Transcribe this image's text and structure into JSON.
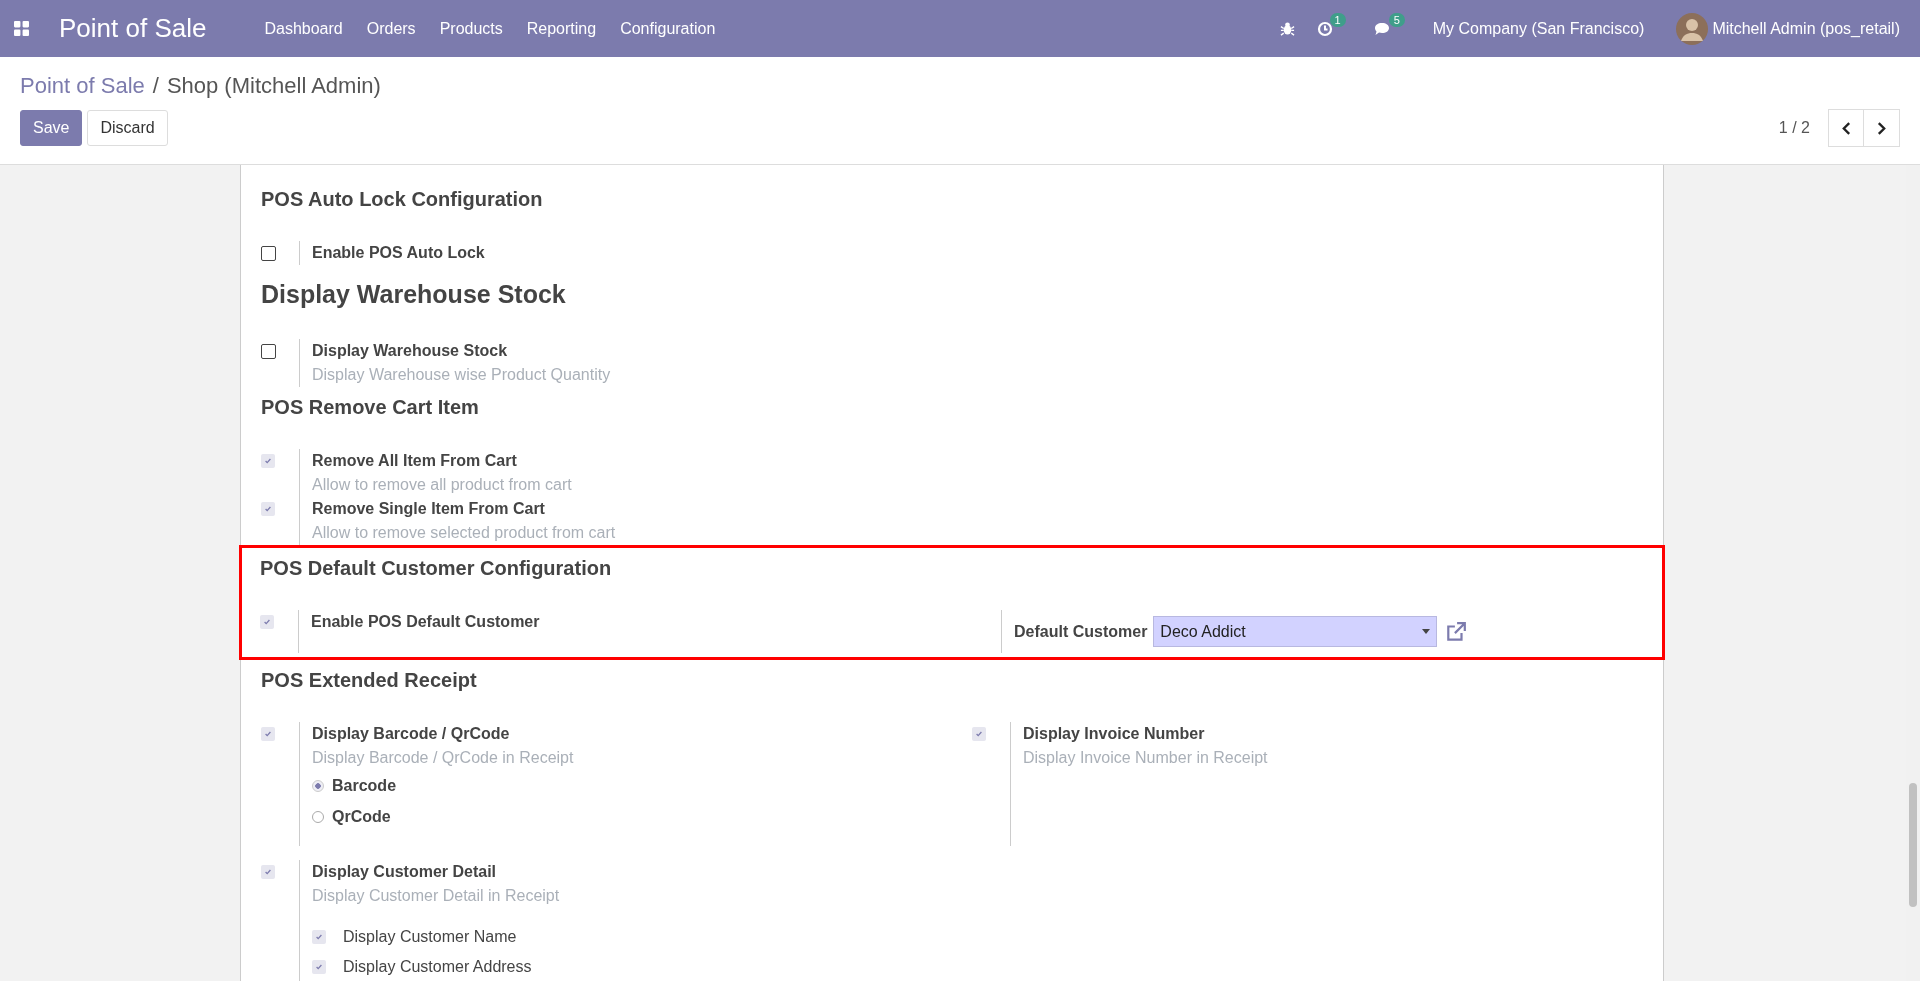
{
  "navbar": {
    "app_name": "Point of Sale",
    "menu": [
      "Dashboard",
      "Orders",
      "Products",
      "Reporting",
      "Configuration"
    ],
    "activity_badge": "1",
    "message_badge": "5",
    "company": "My Company (San Francisco)",
    "user": "Mitchell Admin (pos_retail)"
  },
  "breadcrumb": {
    "items": [
      {
        "label": "Point of Sale",
        "kind": "link"
      },
      {
        "label": "Shop (Mitchell Admin)",
        "kind": "current"
      }
    ],
    "separator": "/"
  },
  "buttons": [
    {
      "label": "Save",
      "kind": "primary"
    },
    {
      "label": "Discard",
      "kind": "secondary"
    }
  ],
  "pager": "1 / 2",
  "sections": [
    {
      "title": "POS Auto Lock Configuration",
      "large": false,
      "highlighted": false,
      "rows": [
        {
          "cells": [
            {
              "kind": "checkbox",
              "label": "Enable POS Auto Lock",
              "checked": false
            }
          ]
        }
      ]
    },
    {
      "title": "Display Warehouse Stock",
      "large": true,
      "highlighted": false,
      "rows": [
        {
          "cells": [
            {
              "kind": "checkbox",
              "label": "Display Warehouse Stock",
              "description": "Display Warehouse wise Product Quantity",
              "checked": false
            }
          ]
        }
      ]
    },
    {
      "title": "POS Remove Cart Item",
      "large": false,
      "highlighted": false,
      "rows": [
        {
          "cells": [
            {
              "kind": "checkbox",
              "label": "Remove All Item From Cart",
              "description": "Allow to remove all product from cart",
              "checked": true
            }
          ]
        },
        {
          "cells": [
            {
              "kind": "checkbox",
              "label": "Remove Single Item From Cart",
              "description": "Allow to remove selected product from cart",
              "checked": true
            }
          ]
        }
      ]
    },
    {
      "title": "POS Default Customer Configuration",
      "large": false,
      "highlighted": true,
      "rows": [
        {
          "cells": [
            {
              "kind": "checkbox",
              "label": "Enable POS Default Customer",
              "checked": true
            },
            {
              "kind": "field",
              "label": "Default Customer",
              "value": "Deco Addict"
            }
          ]
        }
      ]
    },
    {
      "title": "POS Extended Receipt",
      "large": false,
      "highlighted": false,
      "rows": [
        {
          "cells": [
            {
              "kind": "checkbox",
              "label": "Display Barcode / QrCode",
              "description": "Display Barcode / QrCode in Receipt",
              "checked": true,
              "options": [
                {
                  "label": "Barcode",
                  "selected": true
                },
                {
                  "label": "QrCode",
                  "selected": false
                }
              ]
            },
            {
              "kind": "checkbox",
              "label": "Display Invoice Number",
              "description": "Display Invoice Number in Receipt",
              "checked": true
            }
          ]
        },
        {
          "cells": [
            {
              "kind": "checkbox",
              "label": "Display Customer Detail",
              "description": "Display Customer Detail in Receipt",
              "checked": true,
              "subitems": [
                {
                  "label": "Display Customer Name",
                  "checked": true
                },
                {
                  "label": "Display Customer Address",
                  "checked": true
                }
              ]
            }
          ]
        }
      ]
    }
  ]
}
